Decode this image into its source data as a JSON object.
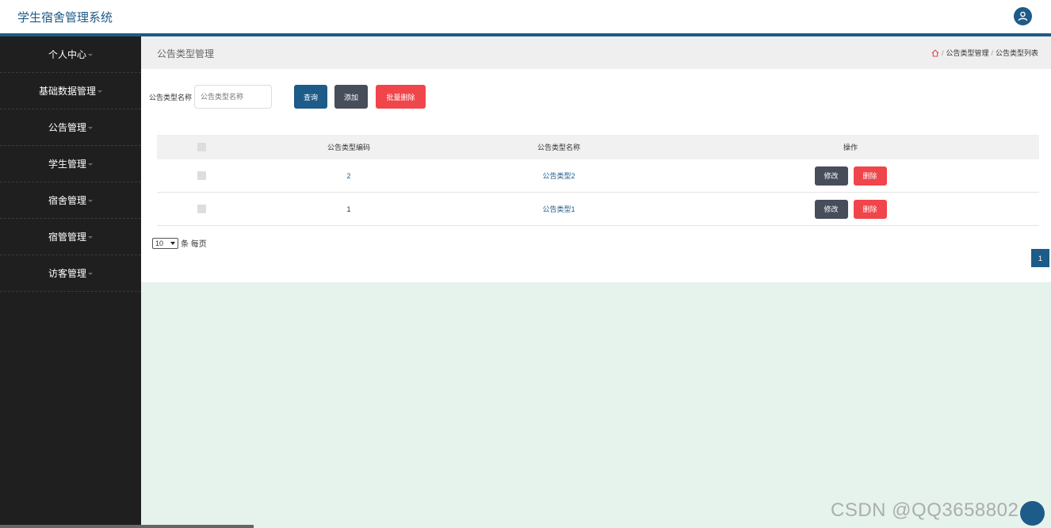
{
  "app": {
    "title": "学生宿舍管理系统"
  },
  "sidebar": {
    "items": [
      {
        "label": "个人中心"
      },
      {
        "label": "基础数据管理"
      },
      {
        "label": "公告管理"
      },
      {
        "label": "学生管理"
      },
      {
        "label": "宿舍管理"
      },
      {
        "label": "宿管管理"
      },
      {
        "label": "访客管理"
      }
    ]
  },
  "page": {
    "title": "公告类型管理",
    "breadcrumb": [
      "公告类型管理",
      "公告类型列表"
    ]
  },
  "search": {
    "label": "公告类型名称",
    "placeholder": "公告类型名称"
  },
  "buttons": {
    "query": "查询",
    "add": "添加",
    "bulk_delete": "批量删除"
  },
  "table": {
    "headers": [
      "公告类型编码",
      "公告类型名称",
      "操作"
    ],
    "rows": [
      {
        "id": "2",
        "name": "公告类型2",
        "edit": "修改",
        "delete": "删除"
      },
      {
        "id": "1",
        "name": "公告类型1",
        "edit": "修改",
        "delete": "删除"
      }
    ]
  },
  "pagination": {
    "page_size": "10",
    "per_page_text": "条 每页",
    "current_page": "1"
  },
  "watermark": "CSDN @QQ3658802",
  "colors": {
    "primary": "#1d5b88",
    "danger": "#f0454b",
    "dark": "#474d5b",
    "sidebar": "#1f1f1f"
  }
}
